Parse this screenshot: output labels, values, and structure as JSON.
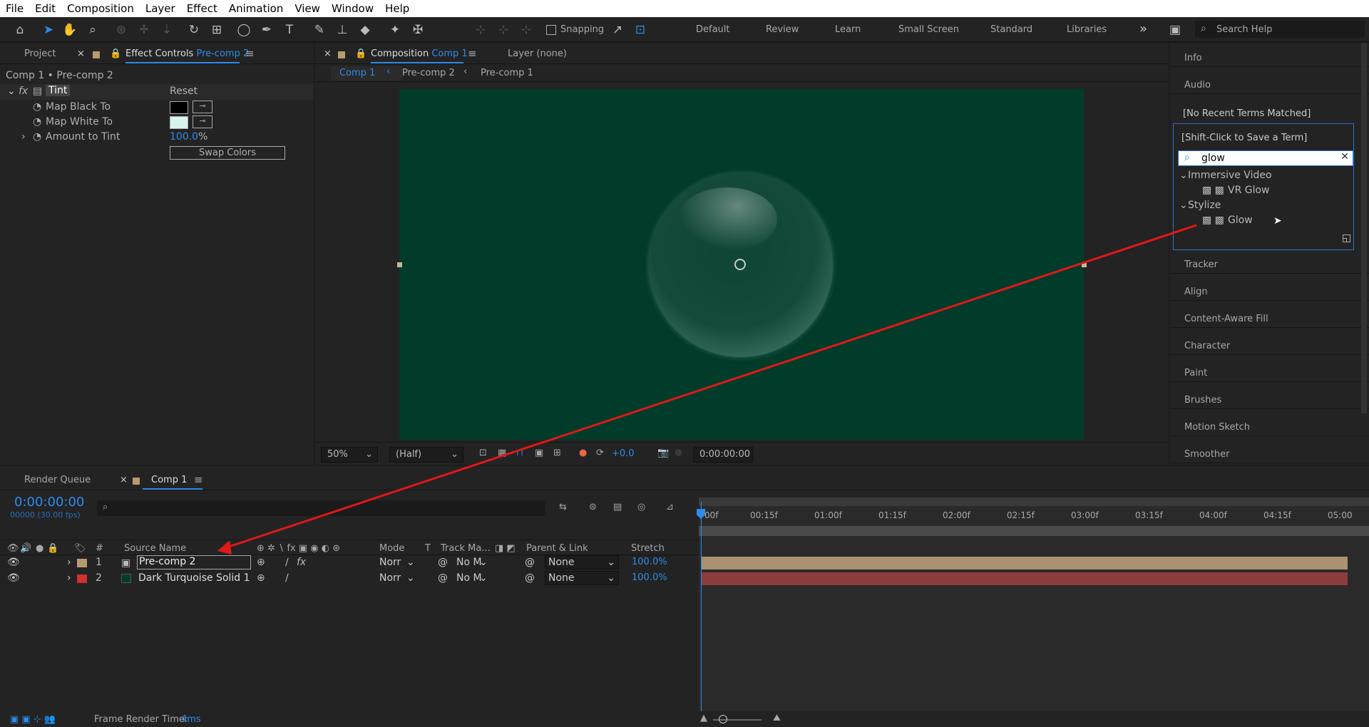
{
  "menu": [
    "File",
    "Edit",
    "Composition",
    "Layer",
    "Effect",
    "Animation",
    "View",
    "Window",
    "Help"
  ],
  "toolbar": {
    "snapping": "Snapping",
    "workspaces": [
      "Default",
      "Review",
      "Learn",
      "Small Screen",
      "Standard",
      "Libraries"
    ],
    "more": "»",
    "search_help": "Search Help"
  },
  "effect_controls": {
    "tab_project": "Project",
    "tab_label": "Effect Controls",
    "tab_layer": "Pre-comp 2",
    "breadcrumb": "Comp 1 • Pre-comp 2",
    "effect_name": "Tint",
    "reset": "Reset",
    "fx": "fx",
    "props": [
      {
        "label": "Map Black To"
      },
      {
        "label": "Map White To"
      },
      {
        "label": "Amount to Tint",
        "value": "100.0",
        "unit": "%"
      }
    ],
    "swap": "Swap Colors",
    "colors": {
      "black": "#000000",
      "white": "#d8f4ee"
    }
  },
  "composition": {
    "tab_label": "Composition",
    "tab_comp": "Comp 1",
    "tab_layer": "Layer (none)",
    "crumbs": [
      "Comp 1",
      "Pre-comp 2",
      "Pre-comp 1"
    ],
    "zoom": "50%",
    "resolution": "(Half)",
    "exposure": "+0.0",
    "timecode": "0:00:00:00",
    "bg_color": "#013b2a"
  },
  "right_panels": {
    "top": [
      "Info",
      "Audio"
    ],
    "recent_1": "[No Recent Terms Matched]",
    "recent_2": "[Shift-Click to Save a Term]",
    "search_value": "glow",
    "tree": [
      {
        "group": "Immersive Video",
        "items": [
          "VR Glow"
        ]
      },
      {
        "group": "Stylize",
        "items": [
          "Glow"
        ]
      }
    ],
    "bottom": [
      "Tracker",
      "Align",
      "Content-Aware Fill",
      "Character",
      "Paint",
      "Brushes",
      "Motion Sketch",
      "Smoother"
    ]
  },
  "timeline": {
    "tab_render": "Render Queue",
    "tab_comp": "Comp 1",
    "timecode": "0:00:00:00",
    "fps": "00000 (30.00 fps)",
    "headers": {
      "num": "#",
      "source": "Source Name",
      "mode": "Mode",
      "t": "T",
      "track": "Track Ma...",
      "parent": "Parent & Link",
      "stretch": "Stretch"
    },
    "ruler": [
      "00f",
      "00:15f",
      "01:00f",
      "01:15f",
      "02:00f",
      "02:15f",
      "03:00f",
      "03:15f",
      "04:00f",
      "04:15f",
      "05:00"
    ],
    "layers": [
      {
        "num": "1",
        "name": "Pre-comp 2",
        "mode": "Norr",
        "track": "No M",
        "parent": "None",
        "stretch": "100.0%",
        "label_color": "#b99a70",
        "bar_color": "#a89272"
      },
      {
        "num": "2",
        "name": "Dark Turquoise Solid 1",
        "mode": "Norr",
        "track": "No M",
        "parent": "None",
        "stretch": "100.0%",
        "label_color": "#d03030",
        "bar_color": "#8c3c3c"
      }
    ],
    "render_label": "Frame Render Time:",
    "render_value": "4ms"
  }
}
